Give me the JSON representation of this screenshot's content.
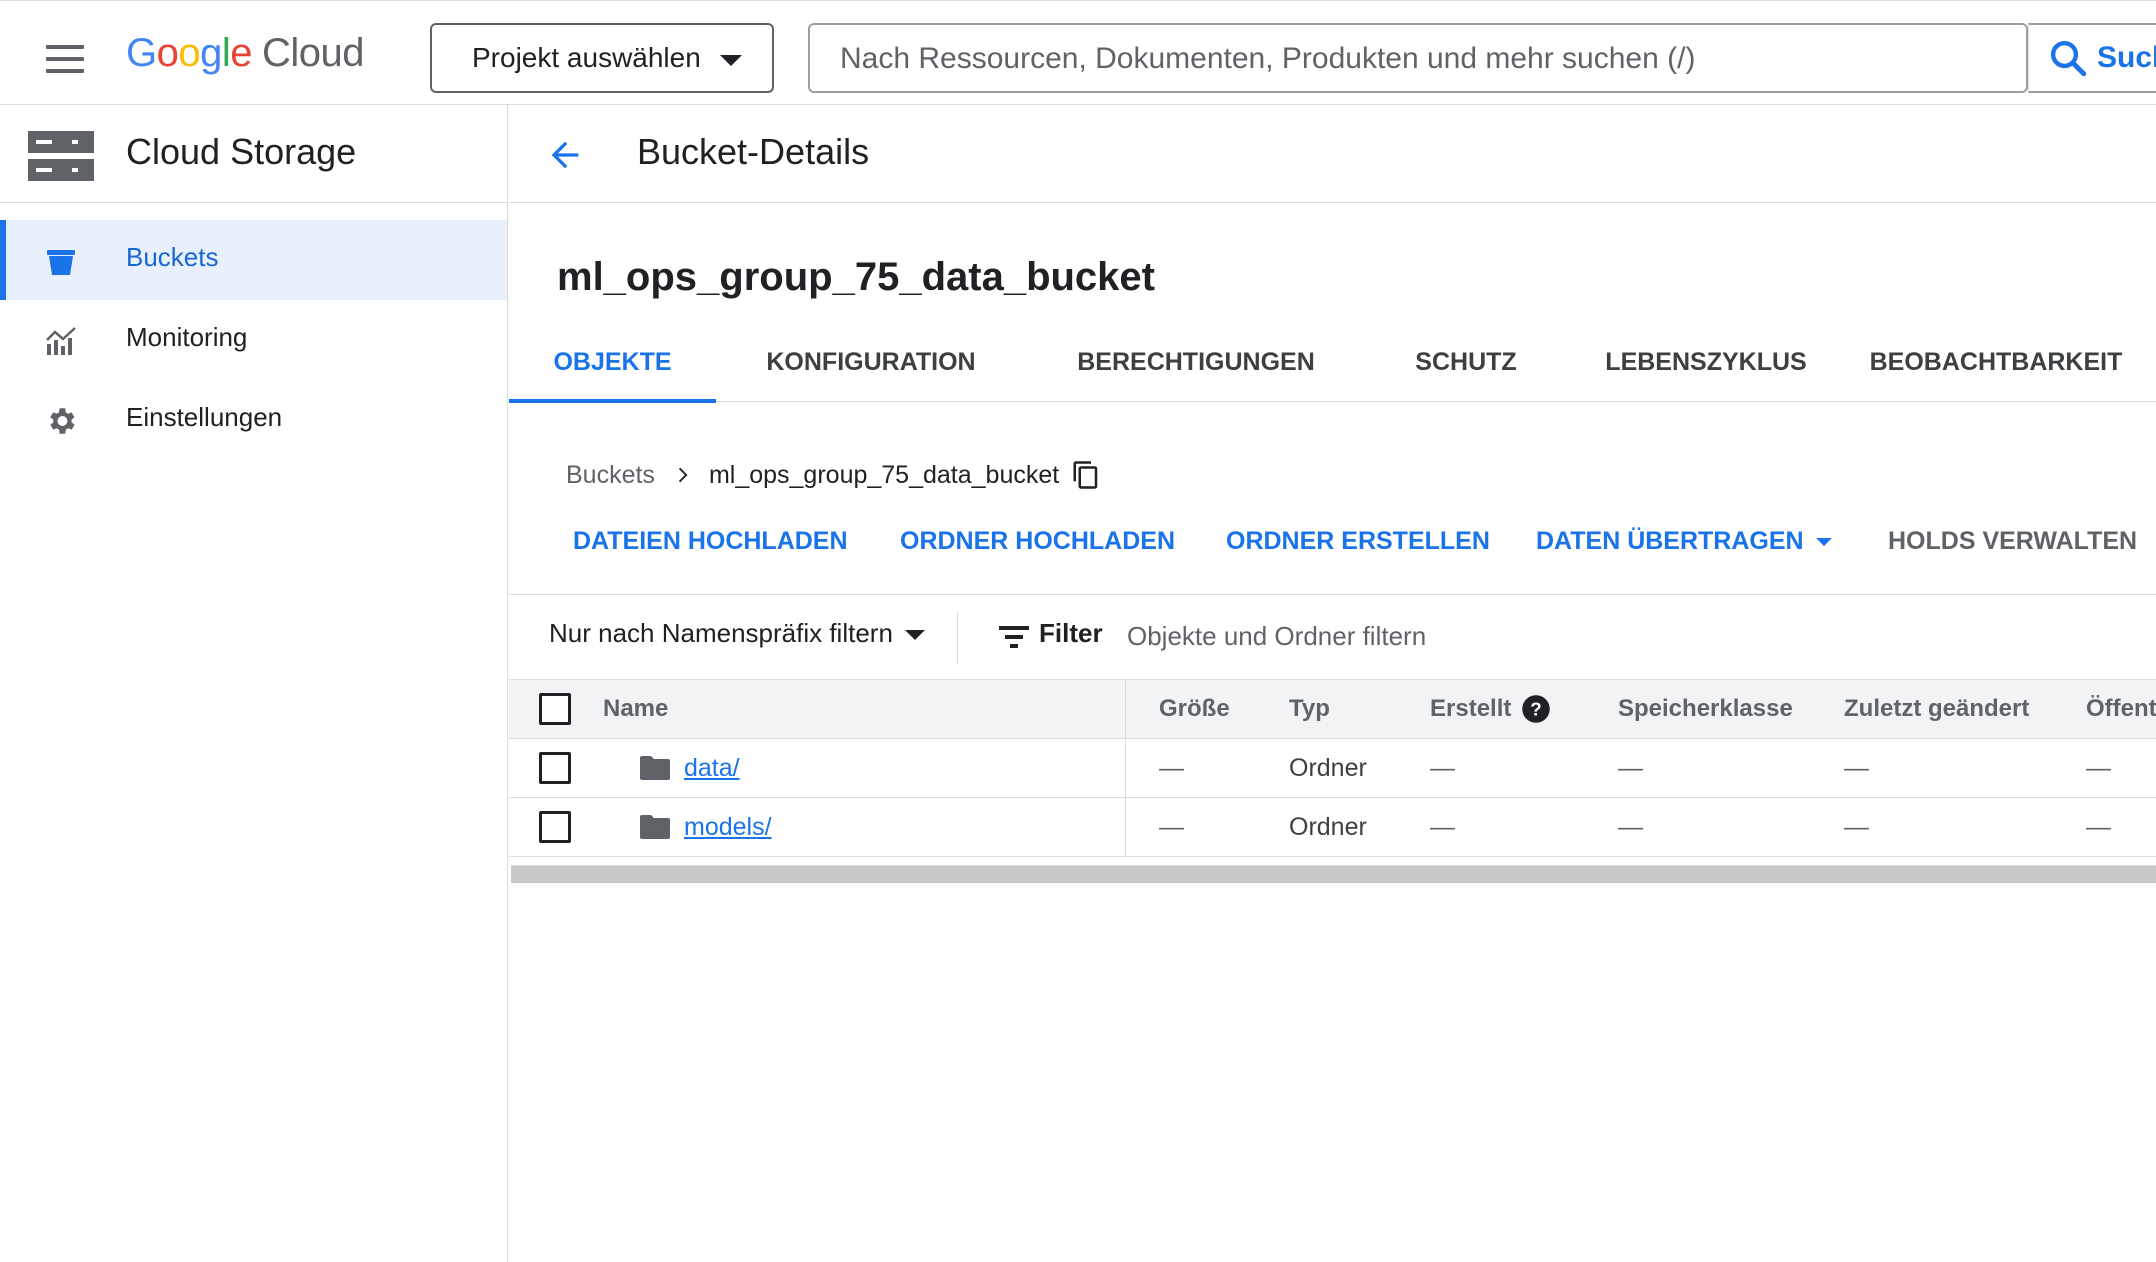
{
  "topbar": {
    "logo_google": "Google",
    "logo_cloud": "Cloud",
    "project_selector": "Projekt auswählen",
    "search_placeholder": "Nach Ressourcen, Dokumenten, Produkten und mehr suchen (/)",
    "search_button": "Such"
  },
  "sidebar": {
    "title": "Cloud Storage",
    "items": [
      {
        "label": "Buckets",
        "icon": "bucket-icon",
        "active": true
      },
      {
        "label": "Monitoring",
        "icon": "monitoring-icon",
        "active": false
      },
      {
        "label": "Einstellungen",
        "icon": "gear-icon",
        "active": false
      }
    ]
  },
  "page": {
    "title": "Bucket-Details",
    "bucket_name": "ml_ops_group_75_data_bucket"
  },
  "tabs": [
    "OBJEKTE",
    "KONFIGURATION",
    "BERECHTIGUNGEN",
    "SCHUTZ",
    "LEBENSZYKLUS",
    "BEOBACHTBARKEIT"
  ],
  "breadcrumb": {
    "root": "Buckets",
    "current": "ml_ops_group_75_data_bucket"
  },
  "actions": [
    "DATEIEN HOCHLADEN",
    "ORDNER HOCHLADEN",
    "ORDNER ERSTELLEN",
    "DATEN ÜBERTRAGEN",
    "HOLDS VERWALTEN"
  ],
  "filter": {
    "prefix_label": "Nur nach Namenspräfix filtern",
    "filter_label": "Filter",
    "placeholder": "Objekte und Ordner filtern"
  },
  "table": {
    "columns": [
      "Name",
      "Größe",
      "Typ",
      "Erstellt",
      "Speicherklasse",
      "Zuletzt geändert",
      "Öffent"
    ],
    "rows": [
      {
        "name": "data/",
        "size": "—",
        "type": "Ordner",
        "created": "—",
        "storage_class": "—",
        "modified": "—",
        "public": "—"
      },
      {
        "name": "models/",
        "size": "—",
        "type": "Ordner",
        "created": "—",
        "storage_class": "—",
        "modified": "—",
        "public": "—"
      }
    ]
  },
  "colors": {
    "accent": "#1a73e8",
    "active_nav_bg": "#e8f0fe",
    "border": "#dadce0"
  }
}
